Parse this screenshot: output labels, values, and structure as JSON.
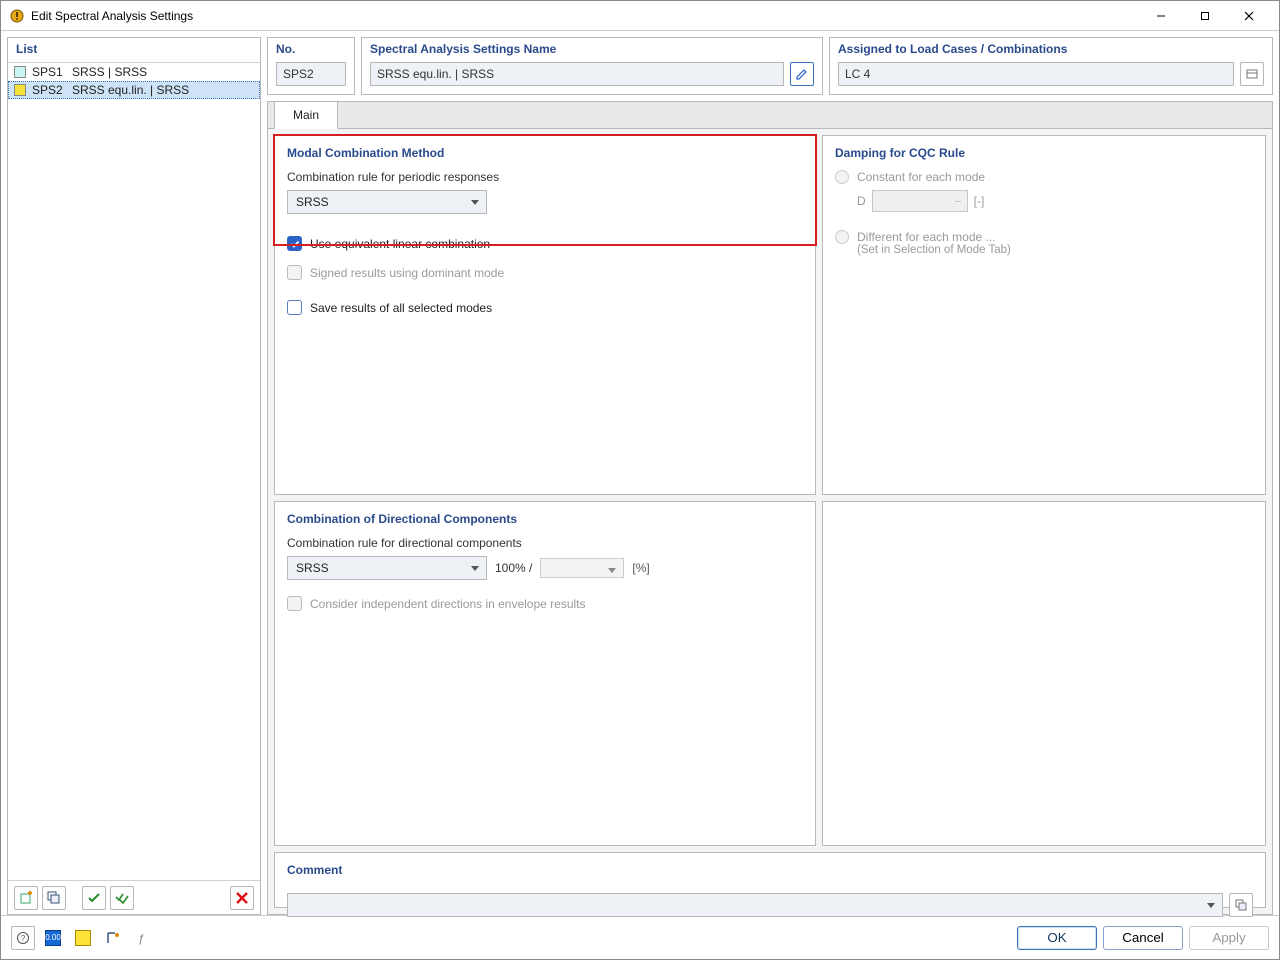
{
  "window": {
    "title": "Edit Spectral Analysis Settings"
  },
  "list": {
    "header": "List",
    "items": [
      {
        "key": "SPS1",
        "label": "SRSS | SRSS",
        "color": "sw-cyan",
        "selected": false
      },
      {
        "key": "SPS2",
        "label": "SRSS equ.lin. | SRSS",
        "color": "sw-yellow",
        "selected": true
      }
    ]
  },
  "fields": {
    "no_header": "No.",
    "no_value": "SPS2",
    "name_header": "Spectral Analysis Settings Name",
    "name_value": "SRSS equ.lin. | SRSS",
    "assigned_header": "Assigned to Load Cases / Combinations",
    "assigned_value": "LC 4"
  },
  "tabs": {
    "main": "Main"
  },
  "modal": {
    "title": "Modal Combination Method",
    "rule_label": "Combination rule for periodic responses",
    "rule_value": "SRSS",
    "use_elc": "Use equivalent linear combination",
    "signed": "Signed results using dominant mode",
    "save_all": "Save results of all selected modes"
  },
  "damping": {
    "title": "Damping for CQC Rule",
    "constant": "Constant for each mode",
    "d_label": "D",
    "d_unit": "[-]",
    "different": "Different for each mode ...",
    "different_sub": "(Set in Selection of Mode Tab)"
  },
  "directional": {
    "title": "Combination of Directional Components",
    "rule_label": "Combination rule for directional components",
    "rule_value": "SRSS",
    "pct_label": "100% /",
    "pct_unit": "[%]",
    "consider": "Consider independent directions in envelope results"
  },
  "comment": {
    "title": "Comment",
    "value": ""
  },
  "buttons": {
    "ok": "OK",
    "cancel": "Cancel",
    "apply": "Apply"
  }
}
